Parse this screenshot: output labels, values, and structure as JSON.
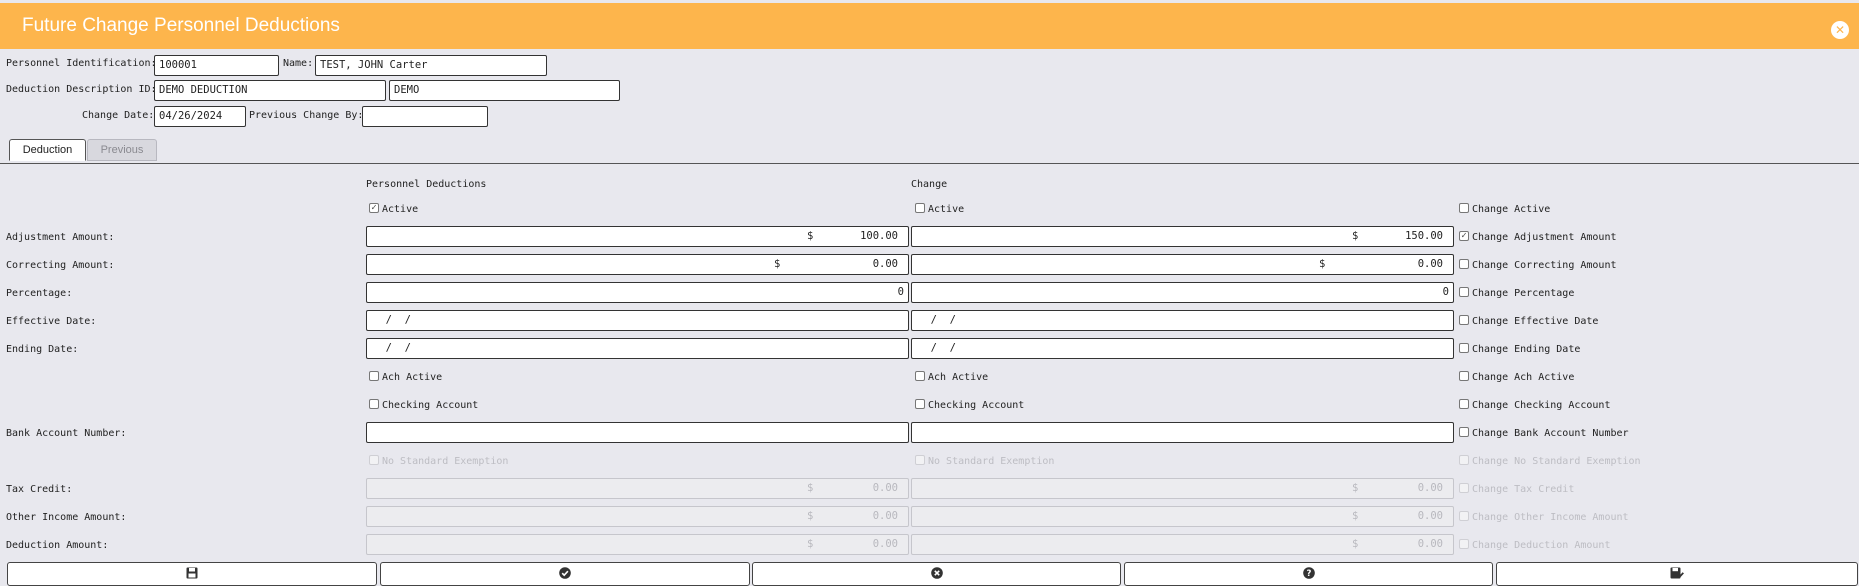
{
  "window": {
    "title": "Future Change Personnel Deductions"
  },
  "header": {
    "personnel_id_label": "Personnel Identification:",
    "personnel_id_value": "100001",
    "name_label": "Name:",
    "name_value": "TEST, JOHN Carter",
    "deduction_id_label": "Deduction Description ID:",
    "deduction_id_value": "DEMO DEDUCTION",
    "deduction_desc_value": "DEMO",
    "change_date_label": "Change Date:",
    "change_date_value": "04/26/2024",
    "prev_change_by_label": "Previous Change By:",
    "prev_change_by_value": ""
  },
  "tabs": [
    {
      "label": "Deduction",
      "active": true
    },
    {
      "label": "Previous",
      "active": false
    }
  ],
  "columns": {
    "current": "Personnel Deductions",
    "change": "Change"
  },
  "rows": {
    "active": {
      "current_label": "Active",
      "current_checked": true,
      "change_label": "Active",
      "change_checked": false,
      "toggle_label": "Change Active",
      "toggle_checked": false
    },
    "adjustment": {
      "label": "Adjustment Amount:",
      "currency": "$",
      "current": "100.00",
      "change": "150.00",
      "toggle_label": "Change Adjustment Amount",
      "toggle_checked": true
    },
    "correcting": {
      "label": "Correcting Amount:",
      "currency": "$",
      "current": "0.00",
      "change": "0.00",
      "toggle_label": "Change Correcting Amount",
      "toggle_checked": false
    },
    "percentage": {
      "label": "Percentage:",
      "current": "0",
      "change": "0",
      "toggle_label": "Change Percentage",
      "toggle_checked": false
    },
    "effective_date": {
      "label": "Effective Date:",
      "current": "  /  /",
      "change": "  /  /",
      "toggle_label": "Change Effective Date",
      "toggle_checked": false
    },
    "ending_date": {
      "label": "Ending Date:",
      "current": "  /  /",
      "change": "  /  /",
      "toggle_label": "Change Ending Date",
      "toggle_checked": false
    },
    "ach_active": {
      "current_label": "Ach Active",
      "change_label": "Ach Active",
      "toggle_label": "Change Ach Active"
    },
    "checking": {
      "current_label": "Checking Account",
      "change_label": "Checking Account",
      "toggle_label": "Change Checking Account"
    },
    "bank_account": {
      "label": "Bank Account Number:",
      "current": "",
      "change": "",
      "toggle_label": "Change Bank Account Number"
    },
    "no_std_exemption": {
      "current_label": "No Standard Exemption",
      "change_label": "No Standard Exemption",
      "toggle_label": "Change No Standard Exemption"
    },
    "tax_credit": {
      "label": "Tax Credit:",
      "currency": "$",
      "current": "0.00",
      "change": "0.00",
      "toggle_label": "Change Tax Credit"
    },
    "other_income": {
      "label": "Other Income Amount:",
      "currency": "$",
      "current": "0.00",
      "change": "0.00",
      "toggle_label": "Change Other Income Amount"
    },
    "deduction_amount": {
      "label": "Deduction Amount:",
      "currency": "$",
      "current": "0.00",
      "change": "0.00",
      "toggle_label": "Change Deduction Amount"
    }
  },
  "icons": {
    "close": "close-circle-icon",
    "save": "floppy-disk-icon",
    "ok": "check-circle-icon",
    "cancel": "x-circle-icon",
    "help": "question-circle-icon",
    "save_done": "floppy-check-icon"
  },
  "colors": {
    "titlebar": "#fdb54c",
    "background": "#e8e8ee"
  }
}
